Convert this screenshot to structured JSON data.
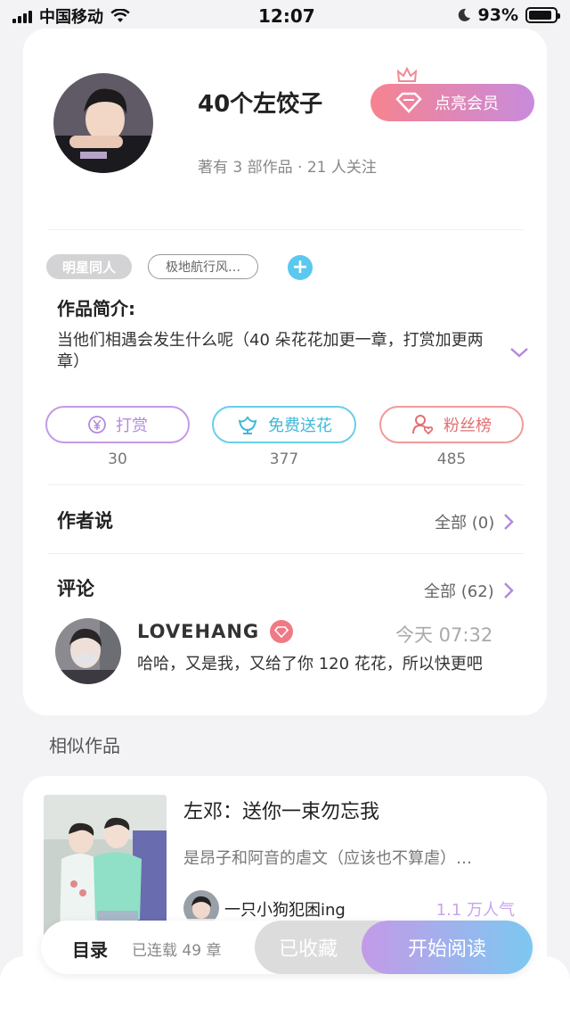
{
  "status_bar": {
    "carrier": "中国移动",
    "time": "12:07",
    "battery": "93%"
  },
  "author": {
    "name": "40个左饺子",
    "stats": "著有 3 部作品 · 21 人关注",
    "vip_label": "点亮会员"
  },
  "tags": {
    "items": [
      "明星同人",
      "极地航行风…"
    ],
    "add_symbol": "+"
  },
  "intro": {
    "title": "作品简介:",
    "text": "当他们相遇会发生什么呢（40 朵花花加更一章，打赏加更两章）"
  },
  "actions": [
    {
      "label": "打赏",
      "count": "30"
    },
    {
      "label": "免费送花",
      "count": "377"
    },
    {
      "label": "粉丝榜",
      "count": "485"
    }
  ],
  "author_says": {
    "title": "作者说",
    "more": "全部 (0)"
  },
  "comments": {
    "title": "评论",
    "more": "全部 (62)",
    "first": {
      "user": "LOVEHANG",
      "time": "今天 07:32",
      "text": "哈哈，又是我，又给了你 120 花花，所以快更吧"
    }
  },
  "similar": {
    "label": "相似作品",
    "book": {
      "title": "左邓：送你一束勿忘我",
      "desc": "是昂子和阿音的虐文（应该也不算虐）…",
      "author": "一只小狗犯困ing",
      "popularity": "1.1 万人气"
    }
  },
  "bottom_bar": {
    "toc": "目录",
    "serial": "已连载 49 章",
    "collected": "已收藏",
    "read": "开始阅读"
  },
  "colors": {
    "vip_gradient_start": "#f6838f",
    "vip_gradient_end": "#c88bdc",
    "reward": "#b38ade",
    "flower": "#3fb8d8",
    "fans": "#e36f74",
    "read_gradient_start": "#c49ae8",
    "read_gradient_end": "#7cc8f0"
  }
}
